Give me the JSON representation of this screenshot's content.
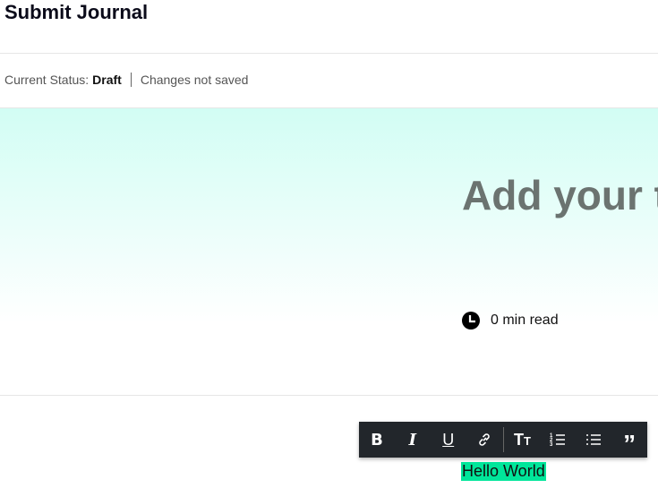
{
  "header": {
    "title": "Submit Journal"
  },
  "status": {
    "label": "Current Status:",
    "value": "Draft",
    "save_state": "Changes not saved"
  },
  "hero": {
    "title_placeholder": "Add your title",
    "read_time": "0 min read",
    "gradient_color": "#d2fdf4"
  },
  "toolbar": {
    "buttons": [
      {
        "name": "bold",
        "glyph": "B"
      },
      {
        "name": "italic",
        "glyph": "I"
      },
      {
        "name": "underline",
        "glyph": "U"
      },
      {
        "name": "link",
        "glyph": "link-icon"
      },
      {
        "name": "text-size",
        "glyph": "TT"
      },
      {
        "name": "ordered-list",
        "glyph": "ordered-list-icon"
      },
      {
        "name": "bullet-list",
        "glyph": "bullet-list-icon"
      },
      {
        "name": "quote",
        "glyph": "quote-icon"
      }
    ]
  },
  "editor": {
    "selected_text": "Hello World",
    "highlight_color": "#00e69a"
  }
}
